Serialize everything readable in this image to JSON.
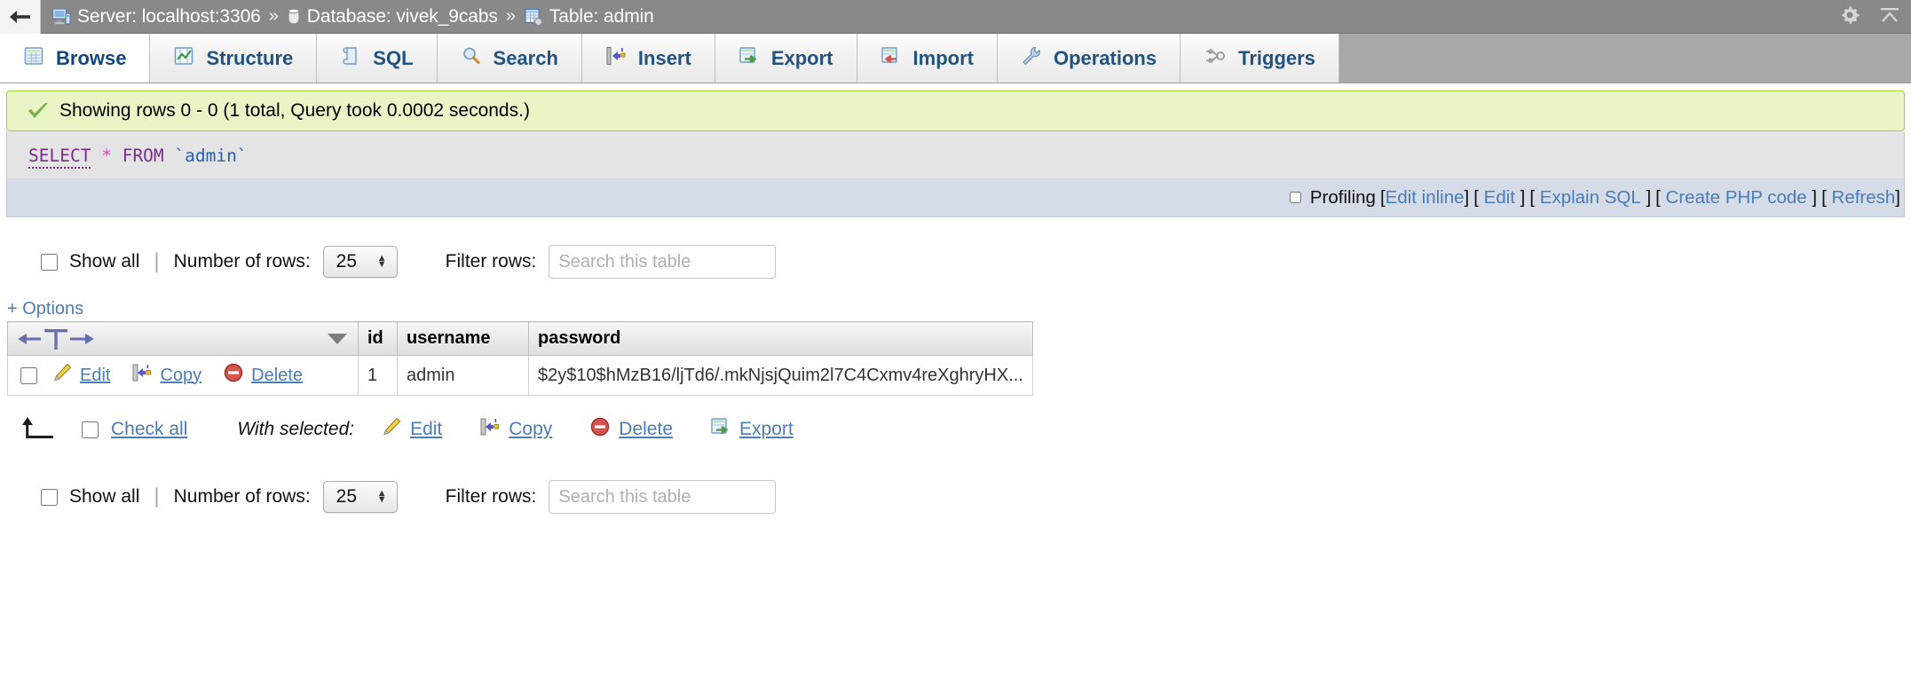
{
  "window": {
    "back_label": "back",
    "gear_label": "settings",
    "collapse_label": "collapse"
  },
  "breadcrumb": {
    "server": "Server: localhost:3306",
    "sep1": "»",
    "database": "Database: vivek_9cabs",
    "sep2": "»",
    "table": "Table: admin"
  },
  "tabs": [
    {
      "label": "Browse",
      "icon": "browse-icon",
      "active": true
    },
    {
      "label": "Structure",
      "icon": "structure-icon",
      "active": false
    },
    {
      "label": "SQL",
      "icon": "sql-icon",
      "active": false
    },
    {
      "label": "Search",
      "icon": "search-icon",
      "active": false
    },
    {
      "label": "Insert",
      "icon": "insert-icon",
      "active": false
    },
    {
      "label": "Export",
      "icon": "export-icon",
      "active": false
    },
    {
      "label": "Import",
      "icon": "import-icon",
      "active": false
    },
    {
      "label": "Operations",
      "icon": "operations-icon",
      "active": false
    },
    {
      "label": "Triggers",
      "icon": "triggers-icon",
      "active": false
    }
  ],
  "notice": {
    "text": "Showing rows 0 - 0 (1 total, Query took 0.0002 seconds.)",
    "icon": "success-check-icon"
  },
  "query": {
    "keyword_select": "SELECT",
    "star": "*",
    "keyword_from": "FROM",
    "identifier": "`admin`"
  },
  "profiling": {
    "label": "Profiling",
    "links": [
      {
        "label": "Edit inline",
        "open": "[",
        "close": "]"
      },
      {
        "label": "Edit",
        "open": "[",
        "close": "]"
      },
      {
        "label": "Explain SQL",
        "open": "[",
        "close": "]"
      },
      {
        "label": "Create PHP code",
        "open": "[",
        "close": "]"
      },
      {
        "label": "Refresh",
        "open": "[",
        "close": "]"
      }
    ]
  },
  "row_controls": {
    "show_all_label": "Show all",
    "divider": "|",
    "number_of_rows_label": "Number of rows:",
    "number_of_rows_value": "25",
    "filter_rows_label": "Filter rows:",
    "filter_placeholder": "Search this table",
    "filter_value": ""
  },
  "options_link": "+ Options",
  "table": {
    "nav_left": "←",
    "nav_t": "T",
    "nav_right": "→",
    "columns": [
      "id",
      "username",
      "password"
    ],
    "row_actions": [
      {
        "label": "Edit",
        "icon": "pencil-icon"
      },
      {
        "label": "Copy",
        "icon": "copy-icon"
      },
      {
        "label": "Delete",
        "icon": "delete-circle-icon"
      }
    ],
    "rows": [
      {
        "id": "1",
        "username": "admin",
        "password": "$2y$10$hMzB16/ljTd6/.mkNjsjQuim2l7C4Cxmv4reXghryHX..."
      }
    ]
  },
  "with_selected": {
    "check_all_label": "Check all",
    "label": "With selected:",
    "actions": [
      {
        "label": "Edit",
        "icon": "pencil-icon"
      },
      {
        "label": "Copy",
        "icon": "copy-icon"
      },
      {
        "label": "Delete",
        "icon": "delete-circle-icon"
      },
      {
        "label": "Export",
        "icon": "export-icon"
      }
    ]
  },
  "colors": {
    "notice_bg": "#eaf5c6",
    "notice_border": "#a2d149",
    "sql_bg": "#e4e4e4",
    "profiling_bg": "#d5dbe7",
    "link": "#4a7cb5",
    "tab_text": "#23527c",
    "topbar_bg": "#898989",
    "keyword": "#7b2d8c",
    "star": "#e040c8",
    "identifier": "#2660b5"
  }
}
